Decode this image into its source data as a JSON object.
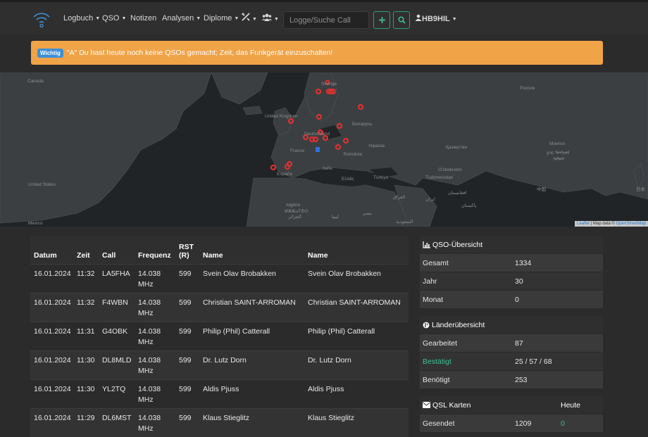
{
  "nav": {
    "items": [
      {
        "label": "Logbuch",
        "dropdown": true
      },
      {
        "label": "QSO",
        "dropdown": true
      },
      {
        "label": "Notizen",
        "dropdown": false
      },
      {
        "label": "Analysen",
        "dropdown": true
      },
      {
        "label": "Diplome",
        "dropdown": true
      }
    ],
    "search_placeholder": "Logge/Suche Call",
    "user": "HB9HIL"
  },
  "alert": {
    "badge": "Wichtig",
    "text": "\"A\" Du hast heute noch keine QSOs gemacht; Zeit, das Funkgerät einzuschalten!"
  },
  "map": {
    "labels": {
      "canada": "Canada",
      "sverige": "Sverige",
      "russia": "Россия",
      "uk": "United Kingdom",
      "belarus": "Беларусь",
      "deutschland": "Deutschland",
      "ukraine": "Україна",
      "kazakhstan": "Қазақстан",
      "mongolia1": "Монгол",
      "mongolia2": "улс ᠮᠣᠩᠭᠣᠯ",
      "mongolia3": "ᠤᠯᠤᠰ",
      "france": "France",
      "romania": "România",
      "uzbekistan": "O'zbekiston",
      "turkmenistan": "Türkmenistan",
      "espana": "España",
      "italia": "Italia",
      "ellas": "Ελλάς",
      "turkiye": "Türkiye",
      "iraq": "العراق",
      "iran": "ایران",
      "afghanistan": "افغانستان",
      "pakistan": "پاکستان",
      "china": "中国",
      "japan": "日本",
      "usa": "United States",
      "algerie1": "Algérie",
      "algerie2": "ⵍⵣⵣⴰⵢⴻⵔ",
      "algerie3": "الجزائر",
      "libya": "ليبيا",
      "egypt": "مصر",
      "saudi": "السعودية",
      "mexico": "México"
    },
    "attribution": {
      "leaflet": "Leaflet",
      "sep": " | Map data © ",
      "osm": "OpenStreetMap"
    }
  },
  "log": {
    "headers": [
      "Datum",
      "Zeit",
      "Call",
      "Frequenz",
      "RST (R)",
      "Name",
      "Name"
    ],
    "rows": [
      {
        "datum": "16.01.2024",
        "zeit": "11:32",
        "call": "LA5FHA",
        "freq": "14.038 MHz",
        "rst": "599",
        "name": "Svein Olav Brobakken",
        "name2": "Svein Olav Brobakken"
      },
      {
        "datum": "16.01.2024",
        "zeit": "11:32",
        "call": "F4WBN",
        "freq": "14.038 MHz",
        "rst": "599",
        "name": "Christian SAINT-ARROMAN",
        "name2": "Christian SAINT-ARROMAN"
      },
      {
        "datum": "16.01.2024",
        "zeit": "11:31",
        "call": "G4OBK",
        "freq": "14.038 MHz",
        "rst": "599",
        "name": "Philip (Phil) Catterall",
        "name2": "Philip (Phil) Catterall"
      },
      {
        "datum": "16.01.2024",
        "zeit": "11:30",
        "call": "DL8MLD",
        "freq": "14.038 MHz",
        "rst": "599",
        "name": "Dr. Lutz Dorn",
        "name2": "Dr. Lutz Dorn"
      },
      {
        "datum": "16.01.2024",
        "zeit": "11:30",
        "call": "YL2TQ",
        "freq": "14.038 MHz",
        "rst": "599",
        "name": "Aldis Pjuss",
        "name2": "Aldis Pjuss"
      },
      {
        "datum": "16.01.2024",
        "zeit": "11:29",
        "call": "DL6MST",
        "freq": "14.038 MHz",
        "rst": "599",
        "name": "Klaus Stieglitz",
        "name2": "Klaus Stieglitz"
      }
    ]
  },
  "qso_overview": {
    "title": "QSO-Übersicht",
    "rows": [
      {
        "label": "Gesamt",
        "value": "1334"
      },
      {
        "label": "Jahr",
        "value": "30"
      },
      {
        "label": "Monat",
        "value": "0"
      }
    ]
  },
  "countries": {
    "title": "Länderübersicht",
    "rows": [
      {
        "label": "Gearbeitet",
        "value": "87"
      },
      {
        "label": "Bestätigt",
        "value": "25 / 57 / 68"
      },
      {
        "label": "Benötigt",
        "value": "253"
      }
    ]
  },
  "qsl": {
    "title": "QSL Karten",
    "today_header": "Heute",
    "rows": [
      {
        "label": "Gesendet",
        "value": "1209",
        "today": "0"
      }
    ]
  },
  "colors": {
    "accent": "#3fbf95",
    "alert": "#f0a347",
    "badge": "#3d8fd6",
    "marker": "#e03030",
    "home": "#2f6fe0"
  }
}
